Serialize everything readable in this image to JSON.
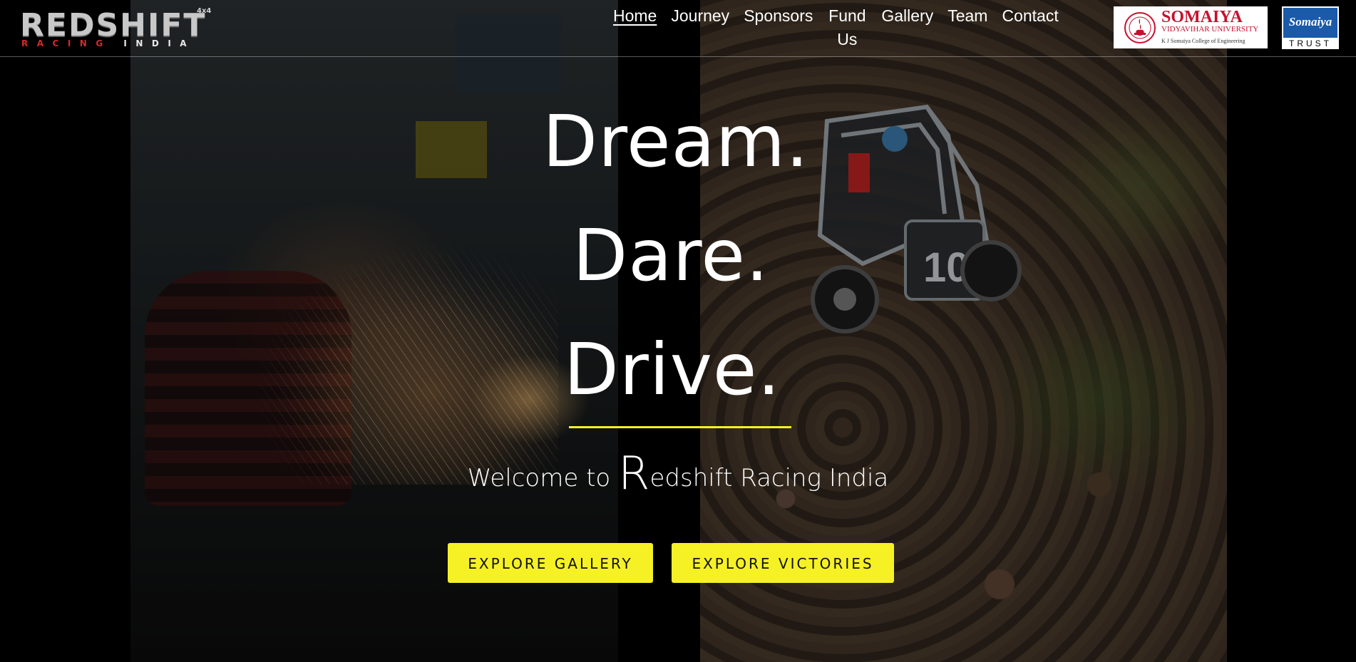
{
  "brand": {
    "logo_main": "REDSHIFT",
    "logo_tag": "4x4",
    "logo_sub_red": "RACING ",
    "logo_sub_white": "INDIA",
    "logo_sub_green": ""
  },
  "nav": {
    "items": [
      {
        "label": "Home",
        "active": true
      },
      {
        "label": "Journey",
        "active": false
      },
      {
        "label": "Sponsors",
        "active": false
      },
      {
        "label": "Fund Us",
        "active": false
      },
      {
        "label": "Gallery",
        "active": false
      },
      {
        "label": "Team",
        "active": false
      },
      {
        "label": "Contact",
        "active": false
      }
    ]
  },
  "partners": {
    "somaiya": {
      "name": "SOMAIYA",
      "university": "VIDYAVIHAR UNIVERSITY",
      "college": "K J Somaiya College of Engineering"
    },
    "trust": {
      "name": "Somaiya",
      "label": "TRUST"
    }
  },
  "hero": {
    "line1": "Dream.",
    "line2": "Dare.",
    "line3": "Drive.",
    "welcome_prefix": "Welcome to ",
    "welcome_initial": "R",
    "welcome_rest": "edshift Racing India"
  },
  "buttons": {
    "gallery": "EXPLORE GALLERY",
    "victories": "EXPLORE VICTORIES"
  },
  "colors": {
    "accent": "#f5f125",
    "background": "#000000",
    "somaiya_red": "#c8102e",
    "trust_blue": "#1a5aa8"
  }
}
